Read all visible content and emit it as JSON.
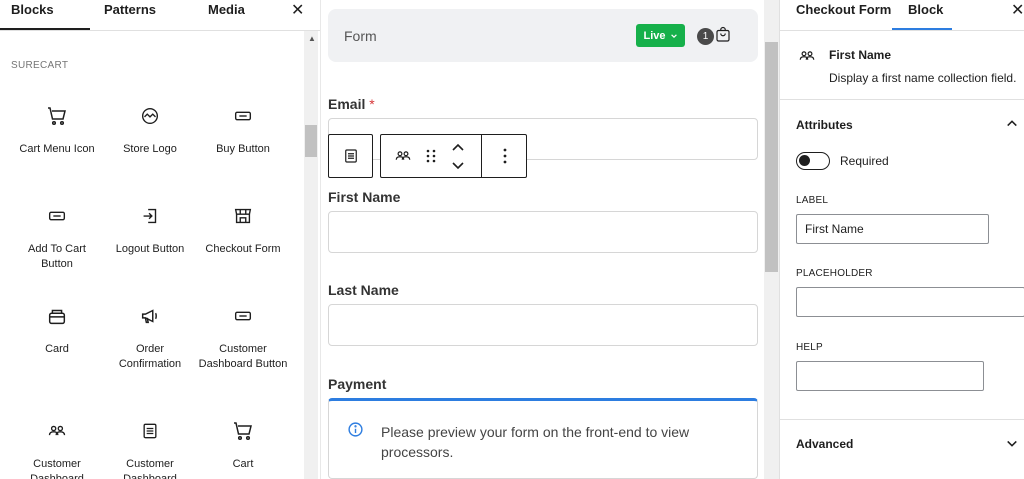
{
  "left_panel": {
    "tabs": [
      "Blocks",
      "Patterns",
      "Media"
    ],
    "section_label": "SURECART",
    "blocks": [
      {
        "label": "Cart Menu Icon",
        "icon": "cart-icon"
      },
      {
        "label": "Store Logo",
        "icon": "store-logo-icon"
      },
      {
        "label": "Buy Button",
        "icon": "button-icon"
      },
      {
        "label": "Add To Cart Button",
        "icon": "button-icon"
      },
      {
        "label": "Logout Button",
        "icon": "logout-icon"
      },
      {
        "label": "Checkout Form",
        "icon": "store-icon"
      },
      {
        "label": "Card",
        "icon": "card-icon"
      },
      {
        "label": "Order Confirmation",
        "icon": "megaphone-icon"
      },
      {
        "label": "Customer Dashboard Button",
        "icon": "button-icon"
      },
      {
        "label": "Customer Dashboard",
        "icon": "users-icon"
      },
      {
        "label": "Customer Dashboard",
        "icon": "list-icon"
      },
      {
        "label": "Cart",
        "icon": "cart-icon"
      }
    ]
  },
  "canvas": {
    "form_header": {
      "title": "Form",
      "mode": "Live",
      "cart_count": "1"
    },
    "fields": {
      "email_label": "Email",
      "required_mark": "*",
      "first_name_label": "First Name",
      "last_name_label": "Last Name",
      "payment_label": "Payment"
    },
    "payment_notice": "Please preview your form on the front-end to view processors."
  },
  "right_panel": {
    "tabs": [
      "Checkout Form",
      "Block"
    ],
    "block_card": {
      "title": "First Name",
      "description": "Display a first name collection field."
    },
    "attributes": {
      "heading": "Attributes",
      "required_label": "Required",
      "required_on": false,
      "label_caption": "LABEL",
      "label_value": "First Name",
      "placeholder_caption": "PLACEHOLDER",
      "placeholder_value": "",
      "help_caption": "HELP",
      "help_value": ""
    },
    "advanced_heading": "Advanced"
  },
  "colors": {
    "live_green": "#16b04a",
    "accent_blue": "#2d7de0",
    "required_red": "#d63638"
  }
}
